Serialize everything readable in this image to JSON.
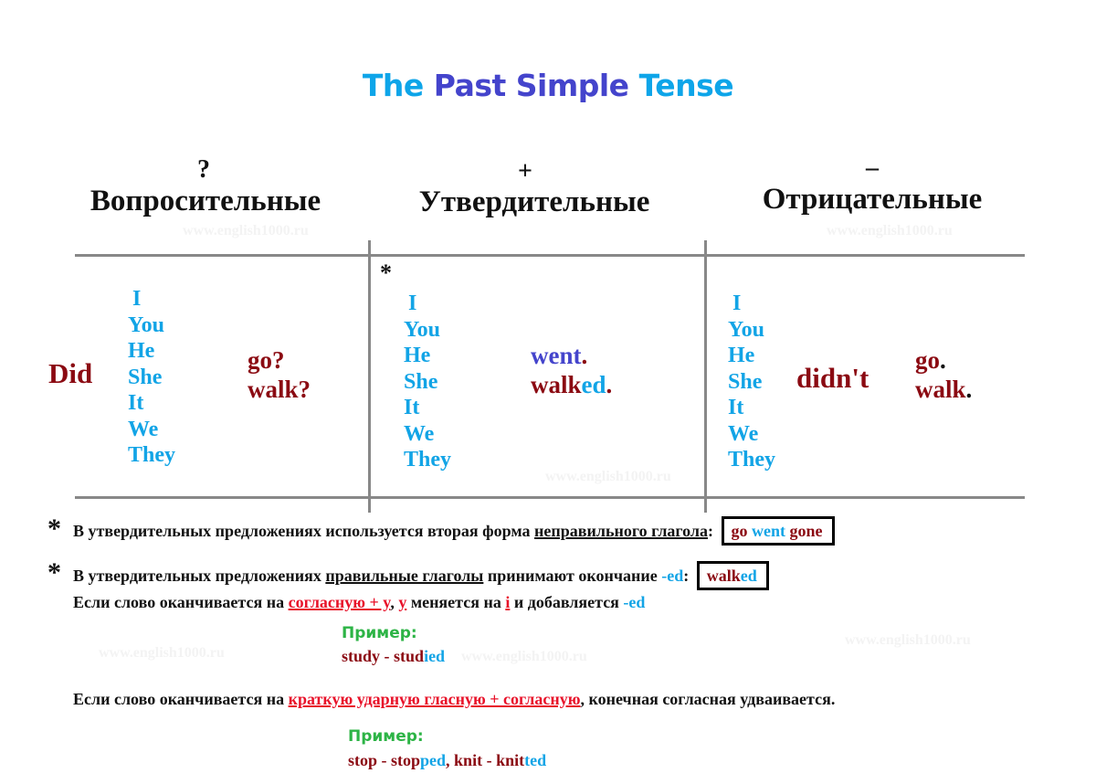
{
  "title": {
    "the": "The",
    "past_simple": "Past Simple",
    "tense": "Tense"
  },
  "columns": [
    {
      "symbol": "?",
      "heading": "Вопросительные",
      "auxiliary": "Did",
      "pronouns": [
        "I",
        "You",
        "He",
        "She",
        "It",
        "We",
        "They"
      ],
      "verbs": [
        "go?",
        "walk?"
      ]
    },
    {
      "symbol": "+",
      "heading": "Утвердительные",
      "footnote_marker": "*",
      "pronouns": [
        "I",
        "You",
        "He",
        "She",
        "It",
        "We",
        "They"
      ],
      "verb_irregular": {
        "stem": "went",
        "punct": "."
      },
      "verb_regular": {
        "stem": "walk",
        "ending": "ed",
        "punct": "."
      }
    },
    {
      "symbol": "–",
      "heading": "Отрицательные",
      "auxiliary": "didn't",
      "pronouns": [
        "I",
        "You",
        "He",
        "She",
        "It",
        "We",
        "They"
      ],
      "verbs": [
        {
          "word": "go",
          "punct": "."
        },
        {
          "word": "walk",
          "punct": "."
        }
      ]
    }
  ],
  "watermark": "www.english1000.ru",
  "notes": {
    "star": "*",
    "note1": {
      "text_before": "В утвердительных предложениях используется вторая форма ",
      "underlined": "неправильного глагола",
      "colon": ":",
      "box": [
        "go",
        "went",
        "gone"
      ]
    },
    "note2": {
      "text_before": "В утвердительных предложениях ",
      "underlined": "правильные глаголы",
      "text_after": " принимают окончание ",
      "ending": "-ed",
      "colon": ":",
      "box": {
        "stem": "walk",
        "ending": "ed"
      }
    },
    "rule_y": {
      "text_before": "Если слово оканчивается на ",
      "red_underlined": "согласную + y",
      "comma": ", ",
      "y": "y",
      "text_mid": " меняется на ",
      "i": "i",
      "text_after": " и добавляется ",
      "ending": "-ed"
    },
    "example1": {
      "label": "Пример:",
      "base": "study",
      "dash": " - ",
      "stem": "stud",
      "ending": "ied"
    },
    "rule_double": {
      "text_before": "Если слово оканчивается на ",
      "red_underlined": "краткую ударную гласную + согласную",
      "text_after": ", конечная согласная удваивается."
    },
    "example2": {
      "label": "Пример:",
      "word1": "stop",
      "dash": " - ",
      "stem1": "stop",
      "ending1": "ped",
      "sep": ", ",
      "word2": "knit",
      "stem2": "knit",
      "ending2": "ted"
    }
  },
  "colors": {
    "title_cyan": "#0ea5e9",
    "title_blue": "#4444cc",
    "pronoun": "#12a4e6",
    "verb_red": "#8b0a12",
    "rule_red": "#e8122a",
    "example_green": "#2db446",
    "grid": "#888888"
  }
}
